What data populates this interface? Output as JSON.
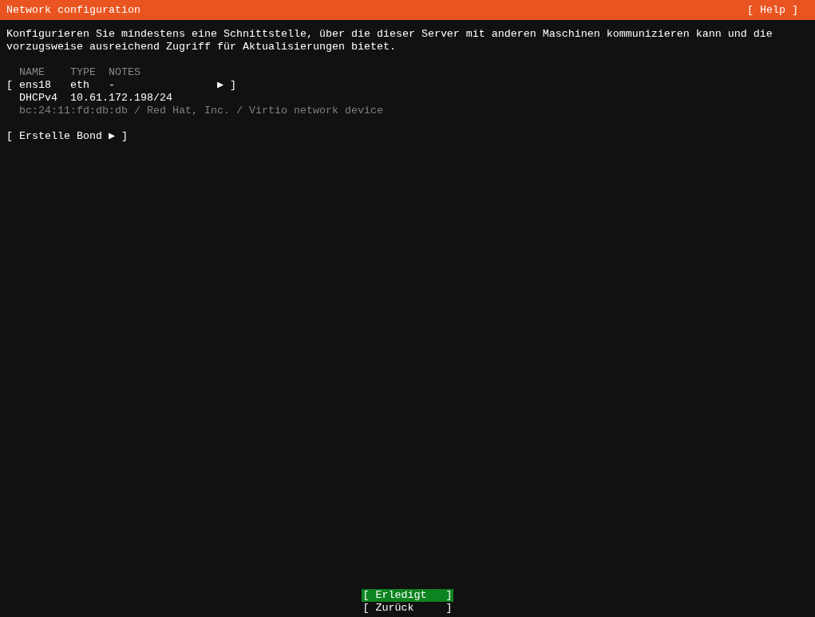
{
  "header": {
    "title": "Network configuration",
    "help_button": "[ Help ]"
  },
  "description": "Konfigurieren Sie mindestens eine Schnittstelle, über die dieser Server mit anderen Maschinen kommunizieren kann und die vorzugsweise ausreichend Zugriff für Aktualisierungen bietet.",
  "table": {
    "columns": [
      "NAME",
      "TYPE",
      "NOTES"
    ],
    "interfaces": [
      {
        "bracket_open": "[",
        "name": "ens18",
        "type": "eth",
        "notes": "-",
        "action": "▶",
        "bracket_close": "]",
        "addresses": [
          {
            "method": "DHCPv4",
            "address": "10.61.172.198/24"
          }
        ],
        "hardware": "bc:24:11:fd:db:db / Red Hat, Inc. / Virtio network device"
      }
    ]
  },
  "create_bond": "[ Erstelle Bond ▶ ]",
  "buttons": [
    {
      "label": "[ Erledigt   ]",
      "selected": true
    },
    {
      "label": "[ Zurück     ]",
      "selected": false
    }
  ]
}
